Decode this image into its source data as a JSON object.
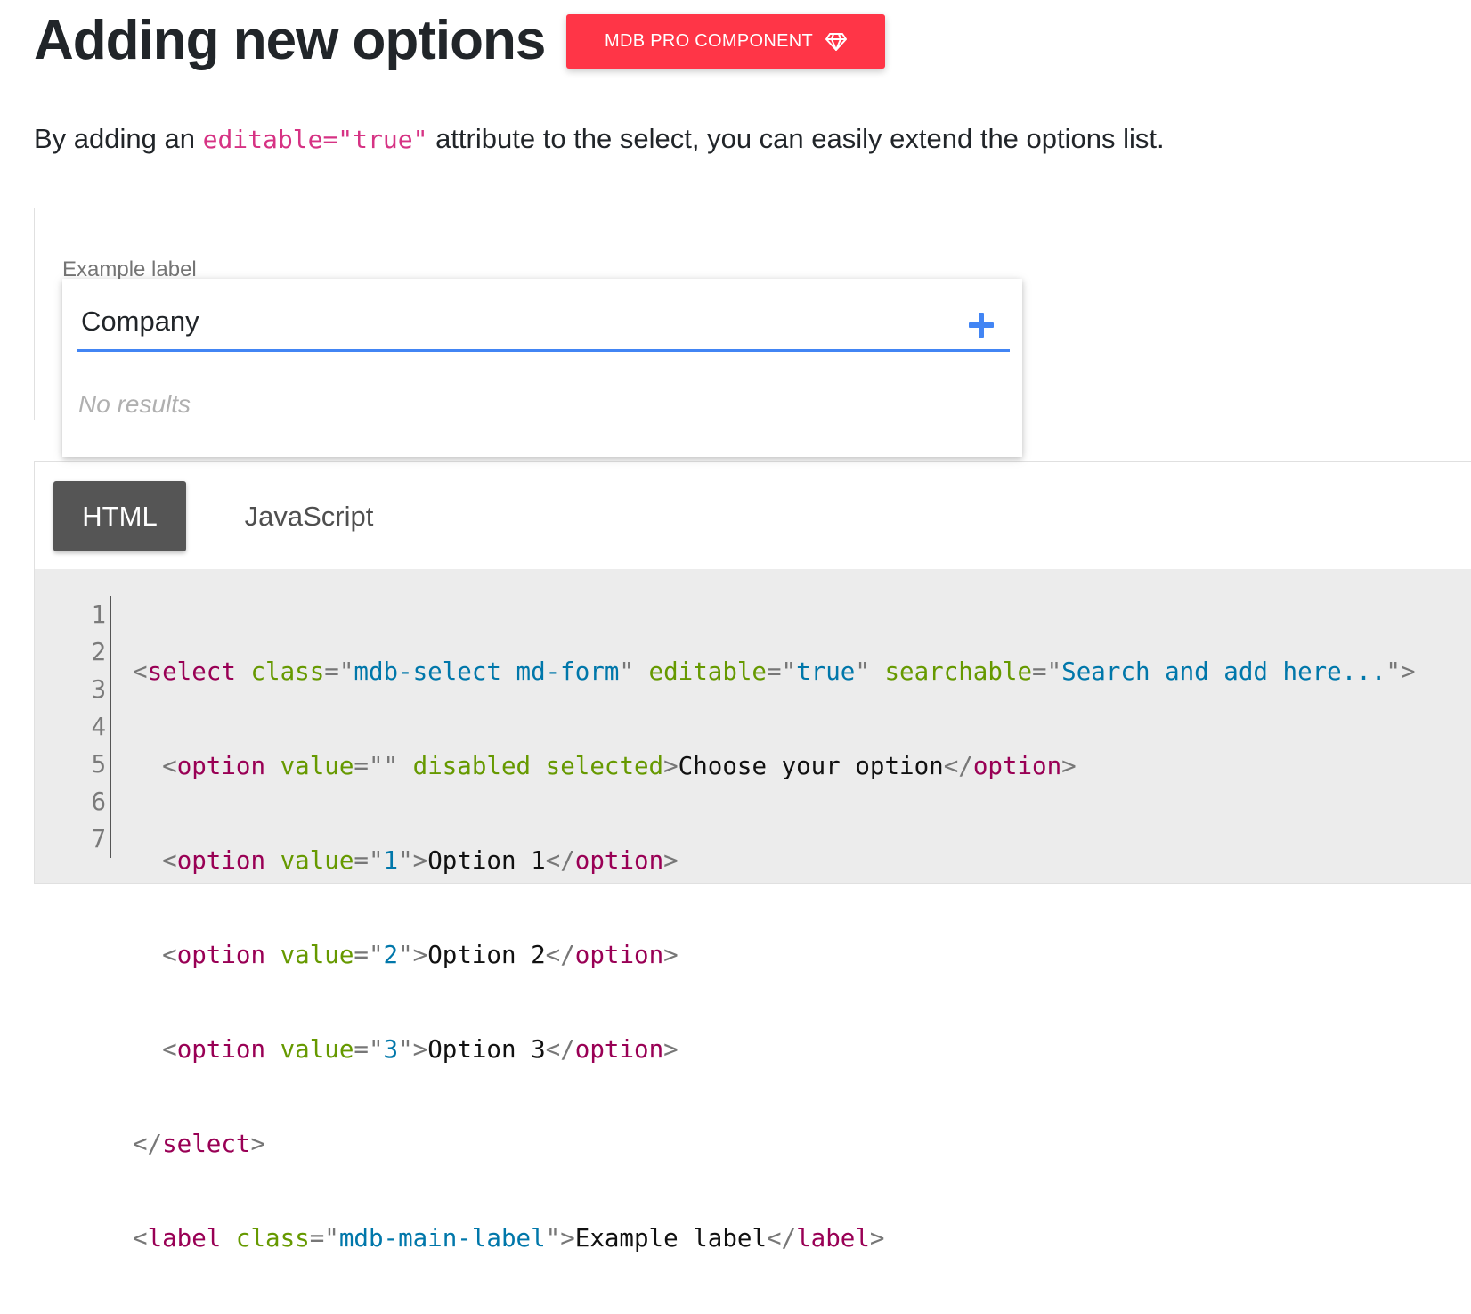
{
  "heading": {
    "title": "Adding new options",
    "badge": "MDB PRO COMPONENT"
  },
  "intro": {
    "before": "By adding an ",
    "code": "editable=\"true\"",
    "after": " attribute to the select, you can easily extend the options list."
  },
  "example": {
    "label": "Example label",
    "search_value": "Company",
    "no_results": "No results"
  },
  "tabs": [
    {
      "label": "HTML",
      "active": true
    },
    {
      "label": "JavaScript",
      "active": false
    }
  ],
  "code": {
    "line_numbers": [
      "1",
      "2",
      "3",
      "4",
      "5",
      "6",
      "7"
    ],
    "line1": {
      "tag": "select",
      "attr1": "class",
      "val1": "mdb-select md-form",
      "attr2": "editable",
      "val2": "true",
      "attr3": "searchable",
      "val3": "Search and add here..."
    },
    "line2": {
      "tag": "option",
      "attr1": "value",
      "val1": "",
      "attr2": "disabled",
      "attr3": "selected",
      "text": "Choose your option"
    },
    "option_lines": [
      {
        "tag": "option",
        "attr": "value",
        "val": "1",
        "text": "Option 1"
      },
      {
        "tag": "option",
        "attr": "value",
        "val": "2",
        "text": "Option 2"
      },
      {
        "tag": "option",
        "attr": "value",
        "val": "3",
        "text": "Option 3"
      }
    ],
    "line6": {
      "tag": "select"
    },
    "line7": {
      "tag": "label",
      "attr": "class",
      "val": "mdb-main-label",
      "text": "Example label"
    }
  },
  "colors": {
    "badge": "#ff3547",
    "accent": "#4285f4",
    "tab_active": "#555555",
    "inline_code": "#d63384"
  },
  "icons": {
    "badge_icon": "gem-icon",
    "add_icon": "plus-icon"
  }
}
